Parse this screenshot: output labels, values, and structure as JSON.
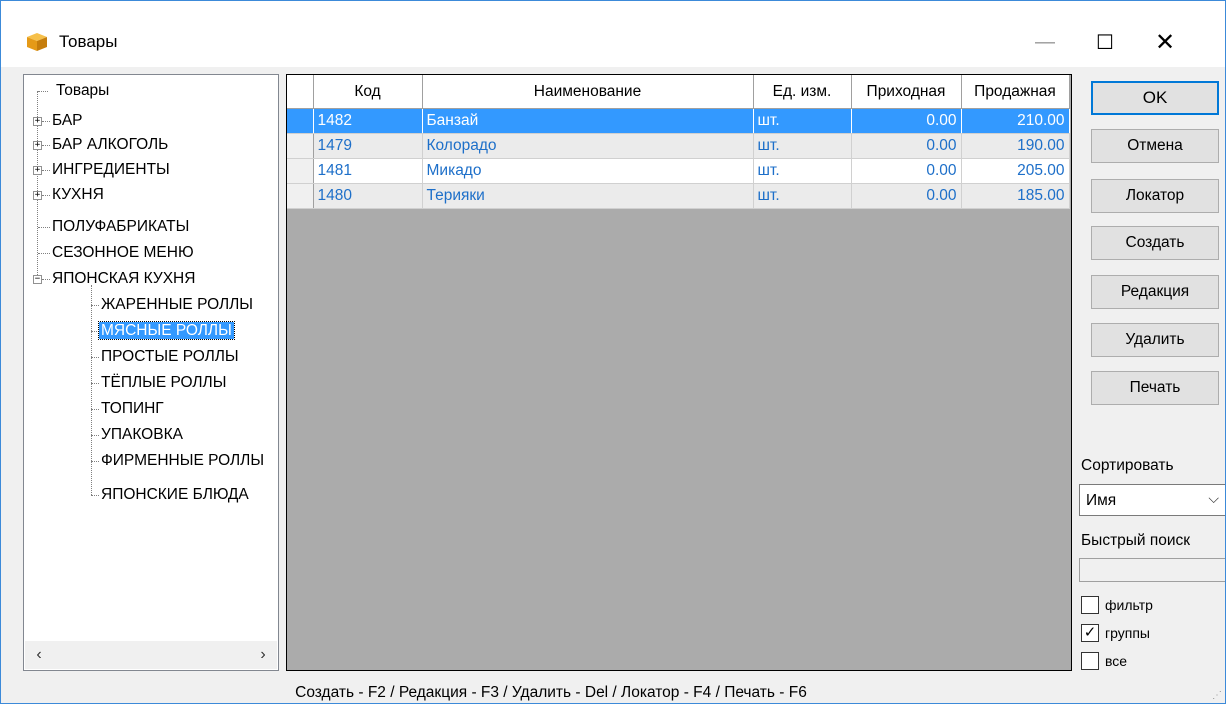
{
  "window": {
    "title": "Товары",
    "minimize": "—",
    "maximize": "☐",
    "close": "✕"
  },
  "tree": {
    "root": "Товары",
    "nodes": [
      "БАР",
      "БАР АЛКОГОЛЬ",
      "ИНГРЕДИЕНТЫ",
      "КУХНЯ",
      "ПОЛУФАБРИКАТЫ",
      "СЕЗОННОЕ МЕНЮ",
      "ЯПОНСКАЯ КУХНЯ"
    ],
    "children": [
      "ЖАРЕННЫЕ РОЛЛЫ",
      "МЯСНЫЕ РОЛЛЫ",
      "ПРОСТЫЕ РОЛЛЫ",
      "ТЁПЛЫЕ РОЛЛЫ",
      "ТОПИНГ",
      "УПАКОВКА",
      "ФИРМЕННЫЕ РОЛЛЫ",
      "ЯПОНСКИЕ БЛЮДА"
    ],
    "expand_plus": "+",
    "expand_minus": "−",
    "scroll_left": "‹",
    "scroll_right": "›"
  },
  "grid": {
    "columns": [
      "Код",
      "Наименование",
      "Ед. изм.",
      "Приходная",
      "Продажная"
    ],
    "rows": [
      {
        "code": "1482",
        "name": "Банзай",
        "unit": "шт.",
        "in_price": "0.00",
        "sale_price": "210.00"
      },
      {
        "code": "1479",
        "name": "Колорадо",
        "unit": "шт.",
        "in_price": "0.00",
        "sale_price": "190.00"
      },
      {
        "code": "1481",
        "name": "Микадо",
        "unit": "шт.",
        "in_price": "0.00",
        "sale_price": "205.00"
      },
      {
        "code": "1480",
        "name": "Терияки",
        "unit": "шт.",
        "in_price": "0.00",
        "sale_price": "185.00"
      }
    ]
  },
  "buttons": {
    "ok": "OK",
    "cancel": "Отмена",
    "locator": "Локатор",
    "create": "Создать",
    "edit": "Редакция",
    "delete": "Удалить",
    "print": "Печать"
  },
  "sort": {
    "label": "Сортировать",
    "value": "Имя",
    "chevron": "⌵"
  },
  "quick_search": {
    "label": "Быстрый поиск",
    "value": ""
  },
  "checkboxes": {
    "filter": {
      "label": "фильтр",
      "checked": false
    },
    "groups": {
      "label": "группы",
      "checked": true
    },
    "all": {
      "label": "все",
      "checked": false
    },
    "check_mark": "✓"
  },
  "status_bar": "Создать - F2 / Редакция - F3 / Удалить - Del / Локатор - F4 / Печать - F6",
  "colors": {
    "selection": "#3399ff",
    "link_text": "#1d6fc9",
    "grid_background": "#ababab",
    "window_border": "#3c8ad9"
  }
}
